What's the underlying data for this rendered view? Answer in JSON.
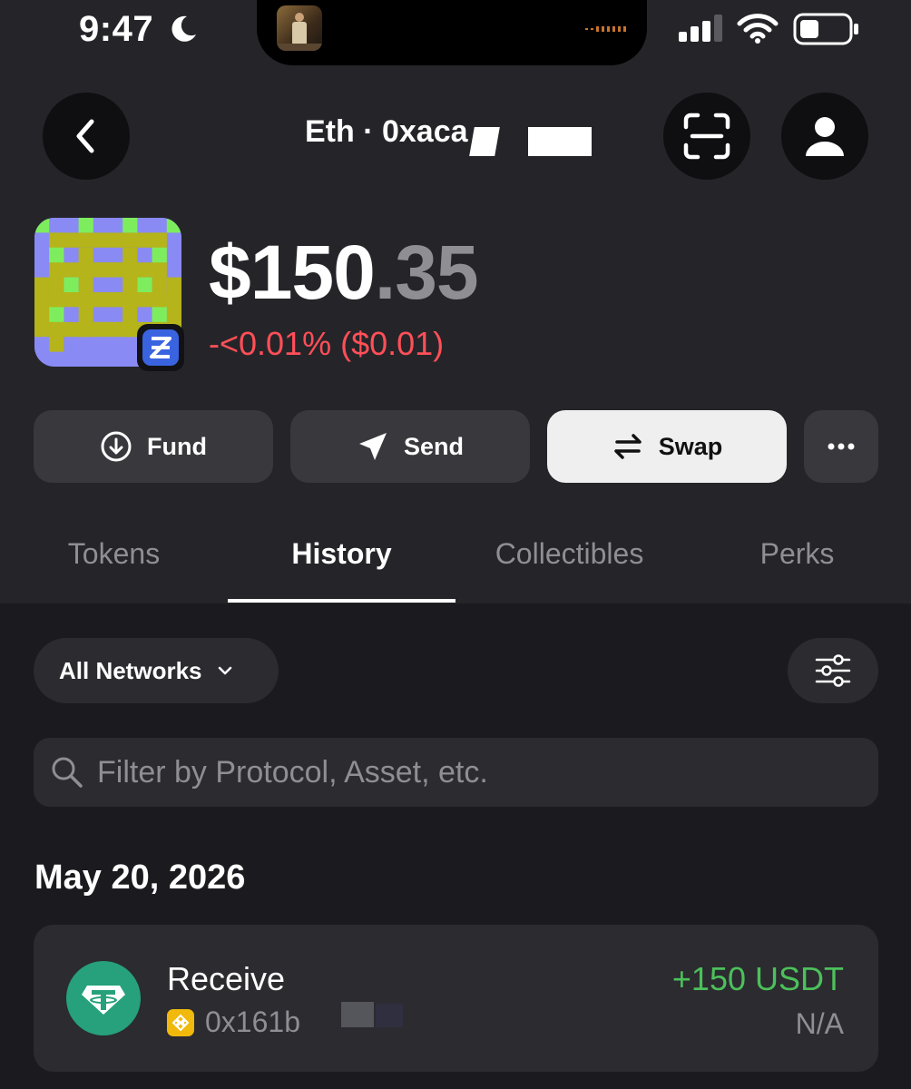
{
  "status_bar": {
    "time": "9:47"
  },
  "header": {
    "title": "Eth · 0xaca"
  },
  "balance": {
    "dollars": "$150",
    "cents": ".35",
    "change": "-<0.01% ($0.01)"
  },
  "actions": {
    "fund": "Fund",
    "send": "Send",
    "swap": "Swap"
  },
  "tabs": [
    {
      "label": "Tokens"
    },
    {
      "label": "History"
    },
    {
      "label": "Collectibles"
    },
    {
      "label": "Perks"
    }
  ],
  "active_tab": "History",
  "filters": {
    "network": "All Networks",
    "search_placeholder": "Filter by Protocol, Asset, etc."
  },
  "history": {
    "date": "May 20, 2026",
    "transactions": [
      {
        "type": "Receive",
        "address": "0x161b",
        "amount": "+150 USDT",
        "value": "N/A",
        "token_icon": "tether-icon",
        "chain_icon": "bnb-icon"
      }
    ]
  },
  "colors": {
    "negative": "#ff4f58",
    "positive": "#4cc05a",
    "tether": "#26a17b",
    "bnb": "#f0b90b",
    "badge": "#3a63e0"
  }
}
